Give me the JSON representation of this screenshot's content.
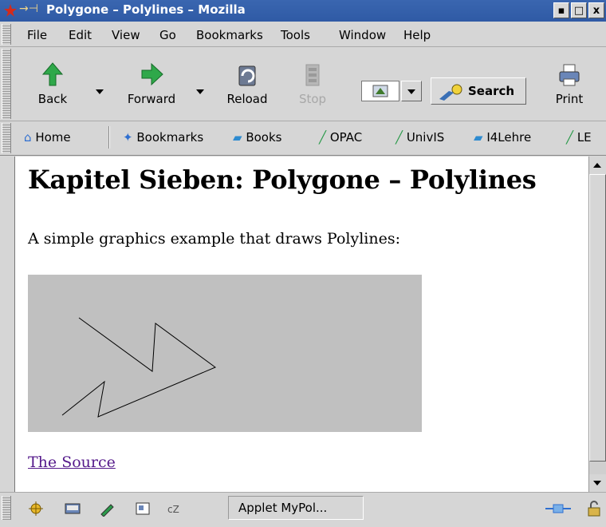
{
  "window": {
    "title": "Polygone – Polylines – Mozilla",
    "controls": [
      "▪",
      "□",
      "x"
    ]
  },
  "menu": {
    "items": [
      {
        "label": "File"
      },
      {
        "label": "Edit"
      },
      {
        "label": "View"
      },
      {
        "label": "Go"
      },
      {
        "label": "Bookmarks"
      },
      {
        "label": "Tools"
      },
      {
        "label": "Window"
      },
      {
        "label": "Help"
      }
    ]
  },
  "nav": {
    "back": "Back",
    "forward": "Forward",
    "reload": "Reload",
    "stop": "Stop",
    "search": "Search",
    "print": "Print"
  },
  "personal_toolbar": {
    "items": [
      {
        "label": "Home",
        "icon": "home-icon"
      },
      {
        "label": "Bookmarks",
        "icon": "bookmarks-icon"
      },
      {
        "label": "Books",
        "icon": "folder-icon"
      },
      {
        "label": "OPAC",
        "icon": "link-icon"
      },
      {
        "label": "UnivIS",
        "icon": "link-icon"
      },
      {
        "label": "I4Lehre",
        "icon": "folder-icon"
      },
      {
        "label": "LE",
        "icon": "link-icon"
      }
    ]
  },
  "page": {
    "heading": "Kapitel Sieben: Polygone – Polylines",
    "intro": "A simple graphics example that draws Polylines:",
    "applet_background": "#c0c0c0",
    "link": "The Source"
  },
  "status": {
    "text": "Applet MyPol..."
  },
  "colors": {
    "titlebar": "#2f5aa5",
    "chrome": "#d6d6d6",
    "visited_link": "#551a8b"
  }
}
